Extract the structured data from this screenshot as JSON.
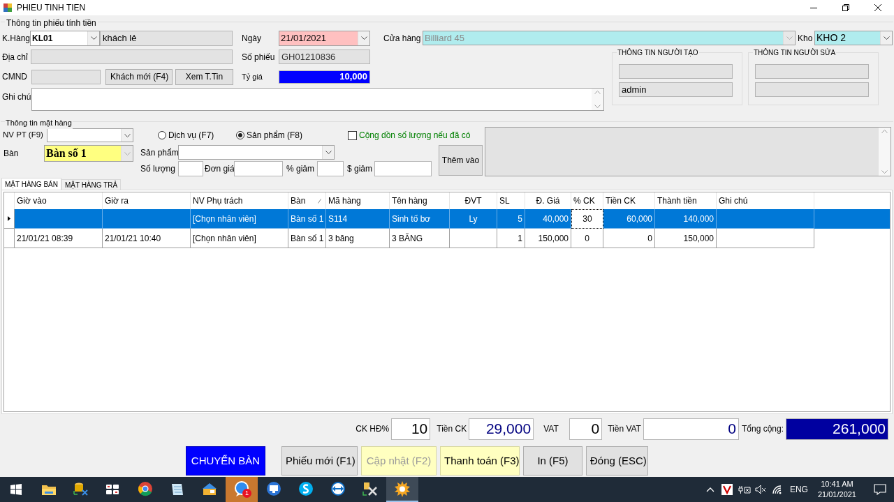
{
  "window": {
    "title": "PHIEU TINH TIEN"
  },
  "invoice_info": {
    "legend": "Thông tin phiếu tính tiền",
    "customer": {
      "label": "K.Hàng",
      "code": "KL01",
      "name": "khách lẻ"
    },
    "address": {
      "label": "Địa chỉ"
    },
    "id_card": {
      "label": "CMND"
    },
    "customer_buttons": [
      "Khách mới (F4)",
      "Xem T.Tin"
    ],
    "note": {
      "label": "Ghi chú"
    },
    "date": {
      "label": "Ngày",
      "value": "21/01/2021"
    },
    "invoice_no": {
      "label": "Số phiếu",
      "value": "GH01210836"
    },
    "rate": {
      "label": "Tỷ giá",
      "value": "10,000"
    },
    "store": {
      "label": "Cửa hàng",
      "value": "Billiard 45",
      "disabled": true
    },
    "warehouse": {
      "label": "Kho",
      "value": "KHO 2"
    },
    "creator": {
      "legend": "THÔNG TIN NGƯỜI TẠO",
      "user": "admin"
    },
    "editor": {
      "legend": "THÔNG TIN NGƯỜI SỬA"
    }
  },
  "item_info": {
    "legend": "Thông tin mặt hàng",
    "staff": {
      "label": "NV PT (F9)"
    },
    "table": {
      "label": "Bàn",
      "value": "Bàn số 1",
      "disabled": true
    },
    "types": [
      {
        "label": "Dịch vụ (F7)",
        "selected": false
      },
      {
        "label": "Sản phẩm (F8)",
        "selected": true
      }
    ],
    "accumulate": {
      "label": "Cộng dồn số lượng nếu đã có",
      "checked": false
    },
    "product": {
      "label": "Sản phẩm"
    },
    "quantity": {
      "label": "Số lượng"
    },
    "unit_price": {
      "label": "Đơn giá"
    },
    "discount_pct": {
      "label": "% giảm"
    },
    "discount_amount": {
      "label": "$ giảm"
    },
    "add_button": "Thêm vào"
  },
  "tabs": [
    {
      "label": "MẶT HÀNG BÁN",
      "selected": true
    },
    {
      "label": "MẶT HÀNG TRẢ",
      "selected": false
    }
  ],
  "grid": {
    "columns": [
      {
        "label": "Giờ vào",
        "sorted": false
      },
      {
        "label": "Giờ ra",
        "sorted": false
      },
      {
        "label": "NV Phụ trách",
        "sorted": false
      },
      {
        "label": "Bàn",
        "sorted": true
      },
      {
        "label": "Mã hàng",
        "sorted": false
      },
      {
        "label": "Tên hàng",
        "sorted": false
      },
      {
        "label": "ĐVT",
        "sorted": false
      },
      {
        "label": "SL",
        "sorted": false
      },
      {
        "label": "Đ. Giá",
        "sorted": false
      },
      {
        "label": "% CK",
        "sorted": false
      },
      {
        "label": "Tiền CK",
        "sorted": false
      },
      {
        "label": "Thành tiền",
        "sorted": false
      },
      {
        "label": "Ghi chú",
        "sorted": false
      }
    ],
    "rows": [
      {
        "selected": true,
        "cells": [
          null,
          null,
          "[Chọn nhân viên]",
          "Bàn số 1",
          "S114",
          "Sinh tố bơ",
          "Ly",
          "5",
          "40,000",
          {
            "text": "30",
            "focused": true
          },
          "60,000",
          "140,000",
          null
        ]
      },
      {
        "selected": false,
        "cells": [
          "21/01/21 08:39",
          "21/01/21 10:40",
          "[Chọn nhân viên]",
          "Bàn số 1",
          "3 băng",
          "3 BĂNG",
          null,
          "1",
          "150,000",
          "0",
          "0",
          "150,000",
          null
        ]
      }
    ]
  },
  "totals": [
    {
      "label": "CK HĐ%",
      "value": "10",
      "kind": "plain"
    },
    {
      "label": "Tiền CK",
      "value": "29,000",
      "kind": "money"
    },
    {
      "label": "VAT",
      "value": "0",
      "kind": "plain"
    },
    {
      "label": "Tiền VAT",
      "value": "0",
      "kind": "money"
    },
    {
      "label": "Tổng cộng:",
      "value": "261,000",
      "kind": "total"
    }
  ],
  "actions": [
    {
      "label": "CHUYỂN BÀN",
      "kind": "primary",
      "disabled": false
    },
    {
      "label": "Phiếu mới (F1)",
      "kind": "normal",
      "disabled": false
    },
    {
      "label": "Cập nhật (F2)",
      "kind": "highlight",
      "disabled": true
    },
    {
      "label": "Thanh toán (F3)",
      "kind": "highlight",
      "disabled": false
    },
    {
      "label": "In (F5)",
      "kind": "normal",
      "disabled": false
    },
    {
      "label": "Đóng (ESC)",
      "kind": "normal",
      "disabled": false
    }
  ],
  "taskbar": {
    "apps": [
      {
        "kind": "folder",
        "flashing": false,
        "active": false
      },
      {
        "kind": "database",
        "flashing": false,
        "active": false
      },
      {
        "kind": "keyboard",
        "flashing": false,
        "active": false
      },
      {
        "kind": "browser",
        "flashing": false,
        "active": false
      },
      {
        "kind": "notepad",
        "flashing": false,
        "active": false
      },
      {
        "kind": "wallet",
        "flashing": false,
        "active": false
      },
      {
        "kind": "chat",
        "flashing": true,
        "active": false,
        "badge": "1"
      },
      {
        "kind": "monitor",
        "flashing": false,
        "active": false
      },
      {
        "kind": "call",
        "flashing": false,
        "active": false
      },
      {
        "kind": "arrows",
        "flashing": false,
        "active": false
      },
      {
        "kind": "tools",
        "flashing": false,
        "active": false
      },
      {
        "kind": "gear",
        "flashing": false,
        "active": true
      }
    ],
    "language": "ENG",
    "time": "10:41 AM",
    "date": "21/01/2021"
  }
}
